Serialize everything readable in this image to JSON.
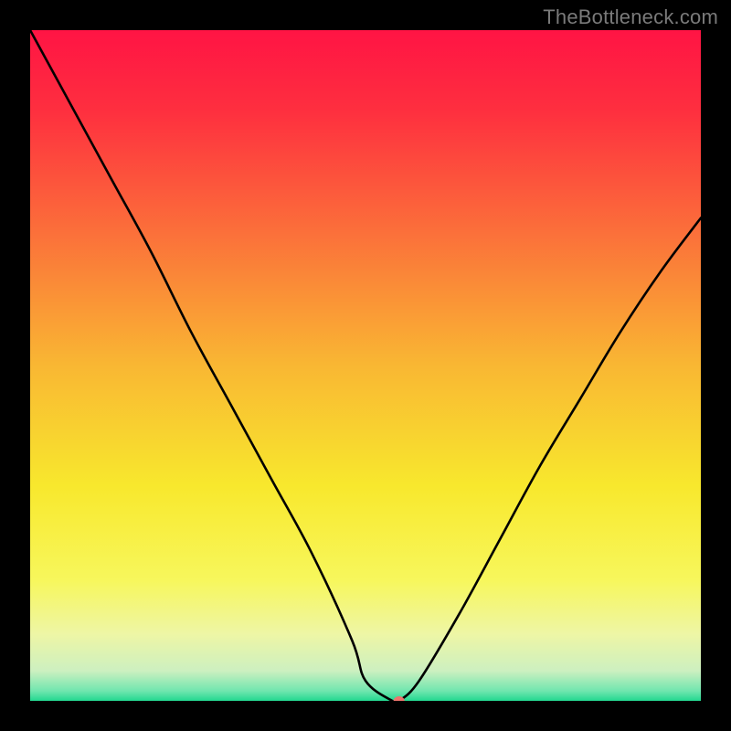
{
  "watermark": "TheBottleneck.com",
  "chart_data": {
    "type": "line",
    "title": "",
    "xlabel": "",
    "ylabel": "",
    "xlim": [
      0,
      100
    ],
    "ylim": [
      0,
      100
    ],
    "gradient_stops": [
      {
        "offset": 0,
        "color": "#ff1444"
      },
      {
        "offset": 0.12,
        "color": "#fe2f3f"
      },
      {
        "offset": 0.3,
        "color": "#fb6f3a"
      },
      {
        "offset": 0.5,
        "color": "#f9b733"
      },
      {
        "offset": 0.68,
        "color": "#f8e82d"
      },
      {
        "offset": 0.82,
        "color": "#f7f75c"
      },
      {
        "offset": 0.9,
        "color": "#eef6a5"
      },
      {
        "offset": 0.955,
        "color": "#cdf0c0"
      },
      {
        "offset": 0.985,
        "color": "#71e6af"
      },
      {
        "offset": 1.0,
        "color": "#22d890"
      }
    ],
    "series": [
      {
        "name": "bottleneck-curve",
        "x": [
          0,
          6,
          12,
          18,
          24,
          30,
          36,
          42,
          48,
          50,
          54,
          55,
          58,
          64,
          70,
          76,
          82,
          88,
          94,
          100
        ],
        "y": [
          100,
          89,
          78,
          67,
          55,
          44,
          33,
          22,
          9,
          3,
          0,
          0,
          3,
          13,
          24,
          35,
          45,
          55,
          64,
          72
        ]
      }
    ],
    "marker": {
      "x": 55,
      "y": 0,
      "rx": 6,
      "ry": 5,
      "color": "#ee736d"
    }
  }
}
